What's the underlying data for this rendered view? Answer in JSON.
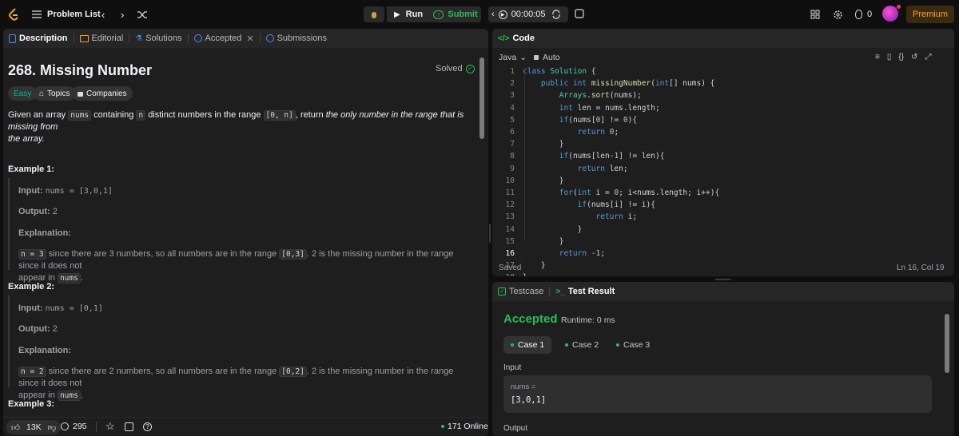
{
  "topbar": {
    "problem_list": "Problem List",
    "run": "Run",
    "submit": "Submit",
    "timer": "00:00:05",
    "streak": "0",
    "premium": "Premium"
  },
  "left_tabs": [
    {
      "label": "Description"
    },
    {
      "label": "Editorial"
    },
    {
      "label": "Solutions"
    },
    {
      "label": "Accepted"
    },
    {
      "label": "Submissions"
    }
  ],
  "problem": {
    "title": "268. Missing Number",
    "status": "Solved",
    "difficulty": "Easy",
    "topics": "Topics",
    "companies": "Companies",
    "desc_1": "Given an array",
    "desc_nums": "nums",
    "desc_2": "containing",
    "desc_n": "n",
    "desc_3": "distinct numbers in the range",
    "desc_range": "[0, n]",
    "desc_4": ", return",
    "desc_5": "the only number in the range that is missing from",
    "desc_6": "the array."
  },
  "examples": [
    {
      "title": "Example 1:",
      "input_label": "Input:",
      "input_value": "nums = [3,0,1]",
      "output_label": "Output:",
      "output_value": "2",
      "explanation_label": "Explanation:",
      "exp_code1": "n = 3",
      "exp_text1": "since there are 3 numbers, so all numbers are in the range",
      "exp_code2": "[0,3]",
      "exp_text2": ". 2 is the missing number in the range since it does not",
      "exp_text3": "appear in",
      "exp_code3": "nums",
      "exp_text4": "."
    },
    {
      "title": "Example 2:",
      "input_label": "Input:",
      "input_value": "nums = [0,1]",
      "output_label": "Output:",
      "output_value": "2",
      "explanation_label": "Explanation:",
      "exp_code1": "n = 2",
      "exp_text1": "since there are 2 numbers, so all numbers are in the range",
      "exp_code2": "[0,2]",
      "exp_text2": ". 2 is the missing number in the range since it does not",
      "exp_text3": "appear in",
      "exp_code3": "nums",
      "exp_text4": "."
    },
    {
      "title": "Example 3:"
    }
  ],
  "footer": {
    "likes": "13K",
    "comments": "295",
    "online": "171 Online"
  },
  "code_panel": {
    "title": "Code",
    "language": "Java",
    "mode": "Auto",
    "saved": "Saved",
    "cursor": "Ln 16, Col 19",
    "lines": [
      "class Solution {",
      "    public int missingNumber(int[] nums) {",
      "        Arrays.sort(nums);",
      "        int len = nums.length;",
      "        if(nums[0] != 0){",
      "            return 0;",
      "        }",
      "        if(nums[len-1] != len){",
      "            return len;",
      "        }",
      "        for(int i = 0; i<nums.length; i++){",
      "            if(nums[i] != i){",
      "                return i;",
      "            }",
      "        }",
      "        return -1;",
      "    }",
      "}"
    ]
  },
  "test_panel": {
    "tab_testcase": "Testcase",
    "tab_result": "Test Result",
    "verdict": "Accepted",
    "runtime": "Runtime: 0 ms",
    "cases": [
      "Case 1",
      "Case 2",
      "Case 3"
    ],
    "input_label": "Input",
    "var_label": "nums =",
    "var_value": "[3,0,1]",
    "output_label": "Output"
  },
  "colors": {
    "accent_green": "#2cbb5d",
    "easy": "#00b8a3",
    "premium": "#ffa116",
    "panel_bg": "#1e1e1e"
  }
}
